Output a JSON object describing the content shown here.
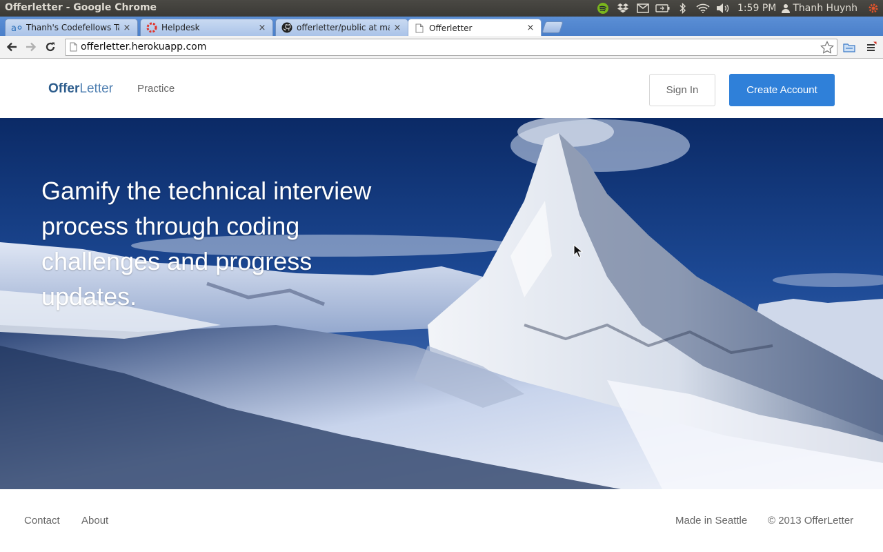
{
  "os_bar": {
    "window_title": "Offerletter - Google Chrome",
    "clock": "1:59 PM",
    "user": "Thanh Huynh",
    "tray_icons": [
      "spotify-icon",
      "dropbox-icon",
      "mail-icon",
      "battery-icon",
      "bluetooth-icon",
      "wifi-icon",
      "volume-icon"
    ]
  },
  "browser": {
    "tabs": [
      {
        "label": "Thanh's Codefellows Task",
        "icon": "asana-icon",
        "close": "×",
        "active": false
      },
      {
        "label": "Helpdesk",
        "icon": "helpdesk-icon",
        "close": "×",
        "active": false
      },
      {
        "label": "offerletter/public at mast",
        "icon": "github-icon",
        "close": "×",
        "active": false
      },
      {
        "label": "Offerletter",
        "icon": "page-icon",
        "close": "×",
        "active": true
      }
    ],
    "url": "offerletter.herokuapp.com"
  },
  "site": {
    "brand_part1": "Offer",
    "brand_part2": "Letter",
    "nav_practice": "Practice",
    "sign_in": "Sign In",
    "create_account": "Create Account",
    "hero_text": "Gamify the technical interview process through coding challenges and progress updates.",
    "footer": {
      "contact": "Contact",
      "about": "About",
      "made_in": "Made in Seattle",
      "copyright": "© 2013 OfferLetter"
    }
  },
  "colors": {
    "accent": "#2f80d9",
    "brand": "#2c5c8c",
    "chrome_tabstrip": "#5b8fd6"
  }
}
